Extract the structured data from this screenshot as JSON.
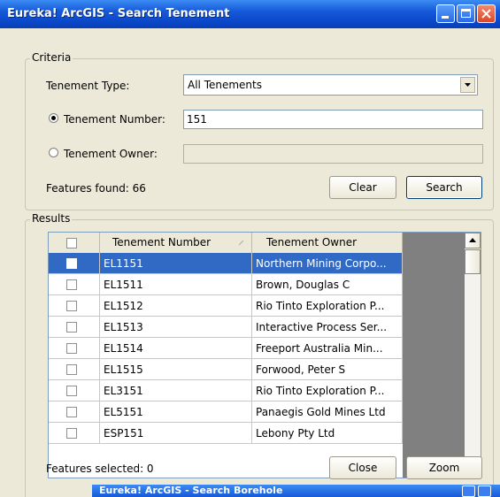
{
  "window": {
    "title": "Eureka! ArcGIS - Search Tenement"
  },
  "criteria": {
    "legend": "Criteria",
    "tenement_type_label": "Tenement Type:",
    "tenement_type_value": "All Tenements",
    "tenement_number_label": "Tenement Number:",
    "tenement_number_value": "151",
    "tenement_owner_label": "Tenement Owner:",
    "tenement_owner_value": "",
    "features_found": "Features found: 66",
    "clear_label": "Clear",
    "search_label": "Search"
  },
  "results": {
    "legend": "Results",
    "columns": [
      "Tenement Number",
      "Tenement Owner"
    ],
    "rows": [
      {
        "number": "EL1151",
        "owner": "Northern Mining Corpo...",
        "selected": true
      },
      {
        "number": "EL1511",
        "owner": "Brown, Douglas C",
        "selected": false
      },
      {
        "number": "EL1512",
        "owner": "Rio Tinto Exploration P...",
        "selected": false
      },
      {
        "number": "EL1513",
        "owner": "Interactive Process Ser...",
        "selected": false
      },
      {
        "number": "EL1514",
        "owner": "Freeport Australia Min...",
        "selected": false
      },
      {
        "number": "EL1515",
        "owner": "Forwood, Peter S",
        "selected": false
      },
      {
        "number": "EL3151",
        "owner": "Rio Tinto Exploration P...",
        "selected": false
      },
      {
        "number": "EL5151",
        "owner": "Panaegis Gold Mines Ltd",
        "selected": false
      },
      {
        "number": "ESP151",
        "owner": "Lebony Pty Ltd",
        "selected": false
      }
    ],
    "features_selected": "Features selected: 0",
    "close_label": "Close",
    "zoom_label": "Zoom"
  },
  "second_window": {
    "title": "Eureka! ArcGIS - Search Borehole"
  },
  "colors": {
    "titlebar": "#0a46c8",
    "selection": "#316ac5",
    "window_bg": "#ece9d8"
  }
}
